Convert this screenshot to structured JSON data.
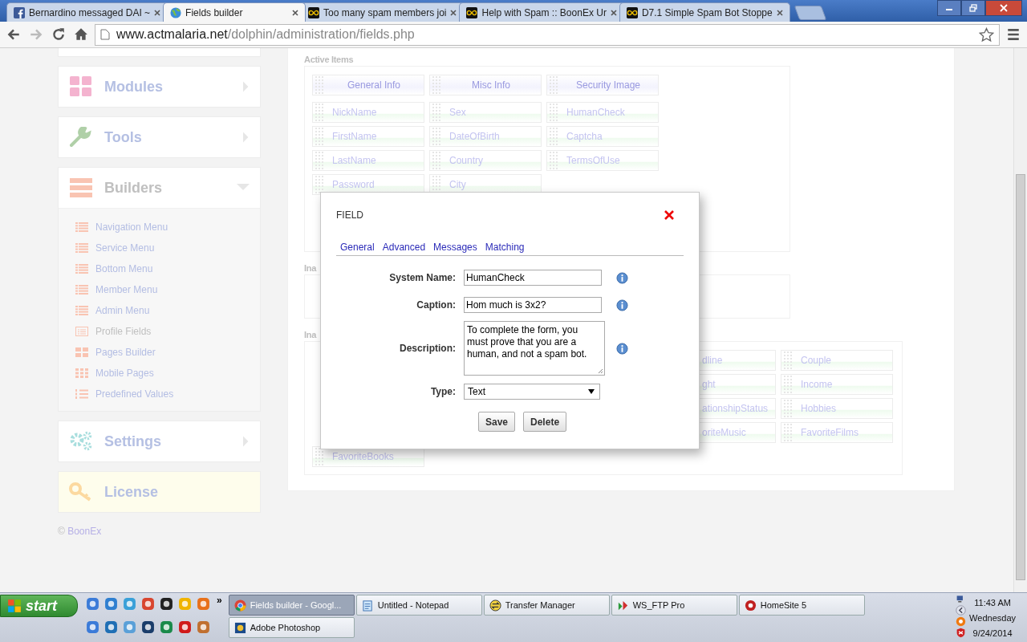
{
  "browser": {
    "tabs": [
      {
        "title": "Bernardino messaged DAI ~",
        "selected": false
      },
      {
        "title": "Fields builder",
        "selected": true
      },
      {
        "title": "Too many spam members joi",
        "selected": false
      },
      {
        "title": "Help with Spam :: BoonEx Ur",
        "selected": false
      },
      {
        "title": "D7.1 Simple Spam Bot Stoppe",
        "selected": false
      }
    ],
    "url": {
      "host": "www.actmalaria.net",
      "path": "/dolphin/administration/fields.php"
    }
  },
  "sidebar": {
    "sections": [
      {
        "title": "Modules",
        "expanded": false
      },
      {
        "title": "Tools",
        "expanded": false
      },
      {
        "title": "Builders",
        "expanded": true,
        "items": [
          {
            "label": "Navigation Menu",
            "selected": false
          },
          {
            "label": "Service Menu",
            "selected": false
          },
          {
            "label": "Bottom Menu",
            "selected": false
          },
          {
            "label": "Member Menu",
            "selected": false
          },
          {
            "label": "Admin Menu",
            "selected": false
          },
          {
            "label": "Profile Fields",
            "selected": true
          },
          {
            "label": "Pages Builder",
            "selected": false
          },
          {
            "label": "Mobile Pages",
            "selected": false
          },
          {
            "label": "Predefined Values",
            "selected": false
          }
        ]
      },
      {
        "title": "Settings",
        "expanded": false
      },
      {
        "title": "License",
        "highlighted": true
      }
    ],
    "footer": {
      "symbol": "©",
      "link": "BoonEx"
    }
  },
  "active_items": {
    "title": "Active Items",
    "items": [
      {
        "label": "General Info",
        "kind": "group"
      },
      {
        "label": "Misc Info",
        "kind": "group"
      },
      {
        "label": "Security Image",
        "kind": "group"
      },
      {
        "label": "NickName",
        "kind": "field"
      },
      {
        "label": "Sex",
        "kind": "field"
      },
      {
        "label": "HumanCheck",
        "kind": "field"
      },
      {
        "label": "FirstName",
        "kind": "field"
      },
      {
        "label": "DateOfBirth",
        "kind": "field"
      },
      {
        "label": "Captcha",
        "kind": "field"
      },
      {
        "label": "LastName",
        "kind": "field"
      },
      {
        "label": "Country",
        "kind": "field"
      },
      {
        "label": "TermsOfUse",
        "kind": "field"
      },
      {
        "label": "Password",
        "kind": "field"
      },
      {
        "label": "City",
        "kind": "field"
      }
    ]
  },
  "inactive_blocks": {
    "title": "Ina"
  },
  "inactive_items": {
    "title": "Ina",
    "right_of_dialog": [
      [
        {
          "label": "dline",
          "cut": true
        },
        {
          "label": "Couple",
          "cut": false
        }
      ],
      [
        {
          "label": "ght",
          "cut": true
        },
        {
          "label": "Income",
          "cut": false
        }
      ],
      [
        {
          "label": "ationshipStatus",
          "cut": true
        },
        {
          "label": "Hobbies",
          "cut": false
        }
      ],
      [
        {
          "label": "oriteMusic",
          "cut": true
        },
        {
          "label": "FavoriteFilms",
          "cut": false
        }
      ]
    ],
    "below_dialog": [
      {
        "label": "FavoriteBooks",
        "cut": false
      }
    ]
  },
  "dialog": {
    "title": "FIELD",
    "tabs": [
      "General",
      "Advanced",
      "Messages",
      "Matching"
    ],
    "fields": [
      {
        "label": "System Name:",
        "kind": "input",
        "value": "HumanCheck"
      },
      {
        "label": "Caption:",
        "kind": "input",
        "value": "Hom much is 3x2?"
      },
      {
        "label": "Description:",
        "kind": "textarea",
        "value": "To complete the form, you must prove that you are a human, and not a spam bot."
      },
      {
        "label": "Type:",
        "kind": "select",
        "value": "Text"
      }
    ],
    "buttons": [
      "Save",
      "Delete"
    ]
  },
  "taskbar": {
    "start": "start",
    "more": "»",
    "tasks": [
      {
        "label": "Fields builder - Googl...",
        "selected": true
      },
      {
        "label": "Untitled - Notepad",
        "selected": false
      },
      {
        "label": "Transfer Manager",
        "selected": false
      },
      {
        "label": "WS_FTP Pro",
        "selected": false
      },
      {
        "label": "HomeSite 5",
        "selected": false
      },
      {
        "label": "Adobe Photoshop",
        "selected": false
      }
    ],
    "clock": {
      "time": "11:43 AM",
      "day": "Wednesday",
      "date": "9/24/2014"
    }
  }
}
